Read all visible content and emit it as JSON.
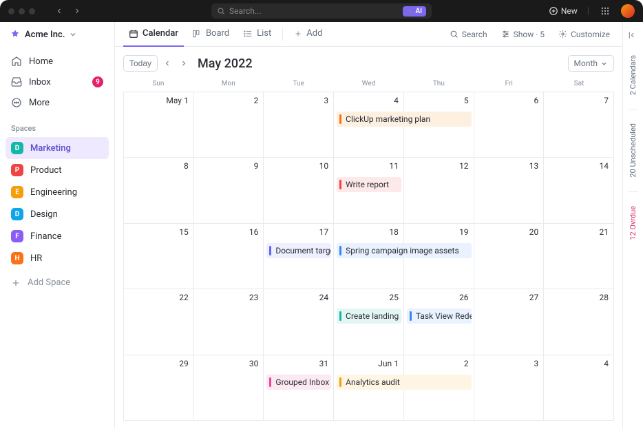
{
  "titlebar": {
    "search_placeholder": "Search...",
    "ai_label": "AI",
    "new_label": "New"
  },
  "workspace": {
    "name": "Acme Inc."
  },
  "nav": {
    "home": "Home",
    "inbox": "Inbox",
    "inbox_badge": "9",
    "more": "More"
  },
  "spaces_header": "Spaces",
  "spaces": [
    {
      "letter": "D",
      "label": "Marketing",
      "color": "#14b8a6"
    },
    {
      "letter": "P",
      "label": "Product",
      "color": "#ef4444"
    },
    {
      "letter": "E",
      "label": "Engineering",
      "color": "#f59e0b"
    },
    {
      "letter": "D",
      "label": "Design",
      "color": "#0ea5e9"
    },
    {
      "letter": "F",
      "label": "Finance",
      "color": "#8b5cf6"
    },
    {
      "letter": "H",
      "label": "HR",
      "color": "#f97316"
    }
  ],
  "add_space": "Add Space",
  "view_tabs": {
    "calendar": "Calendar",
    "board": "Board",
    "list": "List",
    "add": "Add"
  },
  "view_actions": {
    "search": "Search",
    "show": "Show · 5",
    "customize": "Customize"
  },
  "cal": {
    "today": "Today",
    "title": "May 2022",
    "granularity": "Month",
    "dow": [
      "Sun",
      "Mon",
      "Tue",
      "Wed",
      "Thu",
      "Fri",
      "Sat"
    ],
    "weeks": [
      [
        "May 1",
        "2",
        "3",
        "4",
        "5",
        "6",
        "7"
      ],
      [
        "8",
        "9",
        "10",
        "11",
        "12",
        "13",
        "14"
      ],
      [
        "15",
        "16",
        "17",
        "18",
        "19",
        "20",
        "21"
      ],
      [
        "22",
        "23",
        "24",
        "25",
        "26",
        "27",
        "28"
      ],
      [
        "29",
        "30",
        "31",
        "Jun 1",
        "2",
        "3",
        "4"
      ]
    ],
    "events": [
      {
        "title": "ClickUp marketing plan",
        "week": 0,
        "start": 3,
        "span": 2,
        "bar": "#f97316",
        "bg": "#fef0e1"
      },
      {
        "title": "Write report",
        "week": 1,
        "start": 3,
        "span": 1,
        "bar": "#ef4444",
        "bg": "#fde9ea"
      },
      {
        "title": "Document target users",
        "week": 2,
        "start": 2,
        "span": 1,
        "bar": "#6366f1",
        "bg": "#eef0ff"
      },
      {
        "title": "Spring campaign image assets",
        "week": 2,
        "start": 3,
        "span": 2,
        "bar": "#3b82f6",
        "bg": "#e9f2fe"
      },
      {
        "title": "Create landing page",
        "week": 3,
        "start": 3,
        "span": 1,
        "bar": "#14b8a6",
        "bg": "#e3f6f3"
      },
      {
        "title": "Task View Redesign",
        "week": 3,
        "start": 4,
        "span": 1,
        "bar": "#3b82f6",
        "bg": "#e9f2fe"
      },
      {
        "title": "Grouped Inbox Comments",
        "week": 4,
        "start": 2,
        "span": 1,
        "bar": "#ec4899",
        "bg": "#fde9f2"
      },
      {
        "title": "Analytics audit",
        "week": 4,
        "start": 3,
        "span": 2,
        "bar": "#f59e0b",
        "bg": "#fef5e4"
      }
    ]
  },
  "rail": {
    "calendars": "2 Calendars",
    "unscheduled": "20 Unscheduled",
    "overdue": "12 Ovrdue"
  }
}
